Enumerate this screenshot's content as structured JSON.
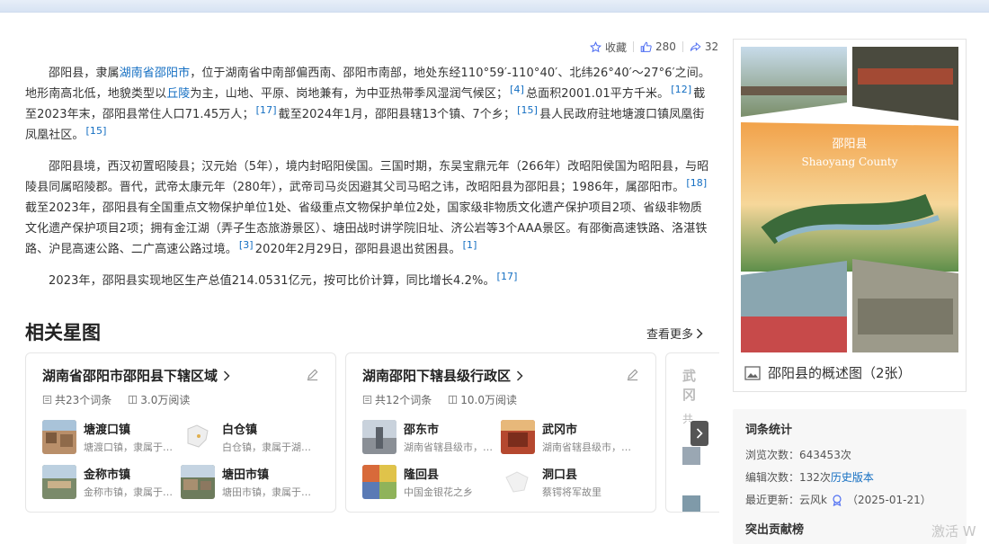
{
  "actions": {
    "collect_label": "收藏",
    "like_count": "280",
    "share_count": "32"
  },
  "article": {
    "p1": {
      "a": "邵阳县，隶属",
      "link": "湖南省邵阳市",
      "b": "，位于湖南省中南部偏西南、邵阳市南部，地处东经110°59′-110°40′、北纬26°40′～27°6′之间。地形南高北低，地貌类型以",
      "link2": "丘陵",
      "c": "为主，山地、平原、岗地兼有，为中亚热带季风湿润气候区；",
      "ref1": "[4]",
      "d": "总面积2001.01平方千米。",
      "ref2": "[12]",
      "e": "截至2023年末，邵阳县常住人口71.45万人；",
      "ref3": "[17]",
      "f": "截至2024年1月，邵阳县辖13个镇、7个乡；",
      "ref4": "[15]",
      "g": "县人民政府驻地塘渡口镇凤凰街凤凰社区。",
      "ref5": "[15]"
    },
    "p2": {
      "a": "邵阳县境，西汉初置昭陵县；汉元始（5年），境内封昭阳侯国。三国时期，东吴宝鼎元年（266年）改昭阳侯国为昭阳县，与昭陵县同属昭陵郡。晋代，武帝太康元年（280年），武帝司马炎因避其父司马昭之讳，改昭阳县为邵阳县；1986年，属邵阳市。",
      "ref1": "[18]",
      "b": "截至2023年，邵阳县有全国重点文物保护单位1处、省级重点文物保护单位2处，国家级非物质文化遗产保护项目2项、省级非物质文化遗产保护项目2项；拥有金江湖（弄子生态旅游景区）、塘田战时讲学院旧址、济公岩等3个AAA景区。有邵衡高速铁路、洛湛铁路、沪昆高速公路、二广高速公路过境。",
      "ref2": "[3]",
      "c": "2020年2月29日，邵阳县退出贫困县。",
      "ref3": "[1]"
    },
    "p3": {
      "a": "2023年，邵阳县实现地区生产总值214.0531亿元，按可比价计算，同比增长4.2%。",
      "ref1": "[17]"
    }
  },
  "related": {
    "title": "相关星图",
    "more": "查看更多",
    "cards": [
      {
        "title": "湖南省邵阳市邵阳县下辖区域",
        "entries": "共23个词条",
        "reads": "3.0万阅读",
        "items": [
          {
            "name": "塘渡口镇",
            "desc": "塘渡口镇，隶属于邵阳县"
          },
          {
            "name": "白仓镇",
            "desc": "白仓镇，隶属于湖南省"
          },
          {
            "name": "金称市镇",
            "desc": "金称市镇，隶属于邵阳县"
          },
          {
            "name": "塘田市镇",
            "desc": "塘田市镇，隶属于邵阳县"
          }
        ]
      },
      {
        "title": "湖南邵阳下辖县级行政区",
        "entries": "共12个词条",
        "reads": "10.0万阅读",
        "items": [
          {
            "name": "邵东市",
            "desc": "湖南省辖县级市，由邵阳市代管"
          },
          {
            "name": "武冈市",
            "desc": "湖南省辖县级市，由邵阳市代管"
          },
          {
            "name": "隆回县",
            "desc": "中国金银花之乡"
          },
          {
            "name": "洞口县",
            "desc": "蔡锷将军故里"
          }
        ]
      },
      {
        "title": "武冈",
        "entries": "共",
        "reads": ""
      }
    ]
  },
  "album": {
    "title_cn": "邵阳县",
    "title_en": "Shaoyang County",
    "caption": "邵阳县的概述图（2张）"
  },
  "stats": {
    "title": "词条统计",
    "views_label": "浏览次数：",
    "views": "643453次",
    "edits_label": "编辑次数：",
    "edits": "132次",
    "history": "历史版本",
    "updated_label": "最近更新：",
    "updated_user": "云风k",
    "updated_date": "（2025-01-21）",
    "contrib_title": "突出贡献榜"
  },
  "watermark": "激活 W",
  "colors": {
    "link": "#136ec2",
    "accent": "#4e6ef2"
  }
}
